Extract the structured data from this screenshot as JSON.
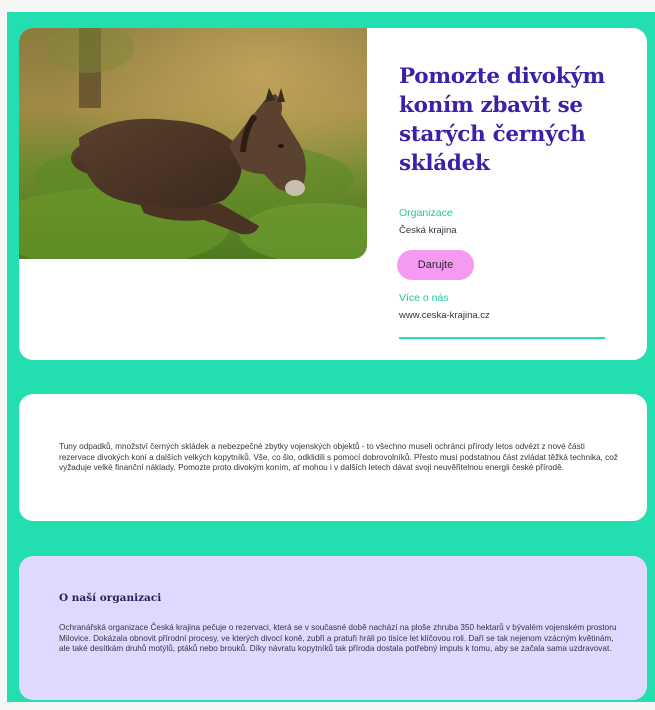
{
  "campaign": {
    "title": "Pomozte divokým koním zbavit se starých černých skládek",
    "organization_label": "Organizace",
    "organization_name": "Česká krajina",
    "donate_label": "Darujte",
    "about_label": "Více o nás",
    "website": "www.ceska-krajina.cz",
    "photo_icon": "horse-foal-photo"
  },
  "description": {
    "text": "Tuny odpadků, množství černých skládek a nebezpečné zbytky vojenských objektů - to všechno museli ochránci přírody letos odvézt z nové části rezervace divokých koní a dalších velkých kopytníků. Vše, co šlo, odklidili s pomocí dobrovolníků. Přesto musí podstatnou část zvládat těžká technika, což vyžaduje velké finanční náklady. Pomozte proto divokým koním, ať mohou i v dalších letech dávat svoji neuvěřitelnou energii české přírodě."
  },
  "about_org": {
    "heading": "O naší organizaci",
    "text": "Ochranářská organizace Česká krajina pečuje o rezervaci, která se v současné době nachází na ploše zhruba 350 hektarů v bývalém vojenském prostoru Milovice. Dokázala obnovit přírodní procesy, ve kterých divocí koně, zubři a pratuři hráli po tisíce let klíčovou roli. Daří se tak nejenom vzácným květinám, ale také desítkám druhů motýlů, ptáků nebo brouků. Díky návratu kopytníků tak příroda dostala potřebný impuls k tomu, aby se začala sama uzdravovat."
  },
  "colors": {
    "page_background": "#23dfb0",
    "card_background": "#ffffff",
    "about_background": "#e0d9ff",
    "title": "#3d1fa8",
    "accent_label": "#20c79e",
    "donate_button": "#f49af0"
  }
}
